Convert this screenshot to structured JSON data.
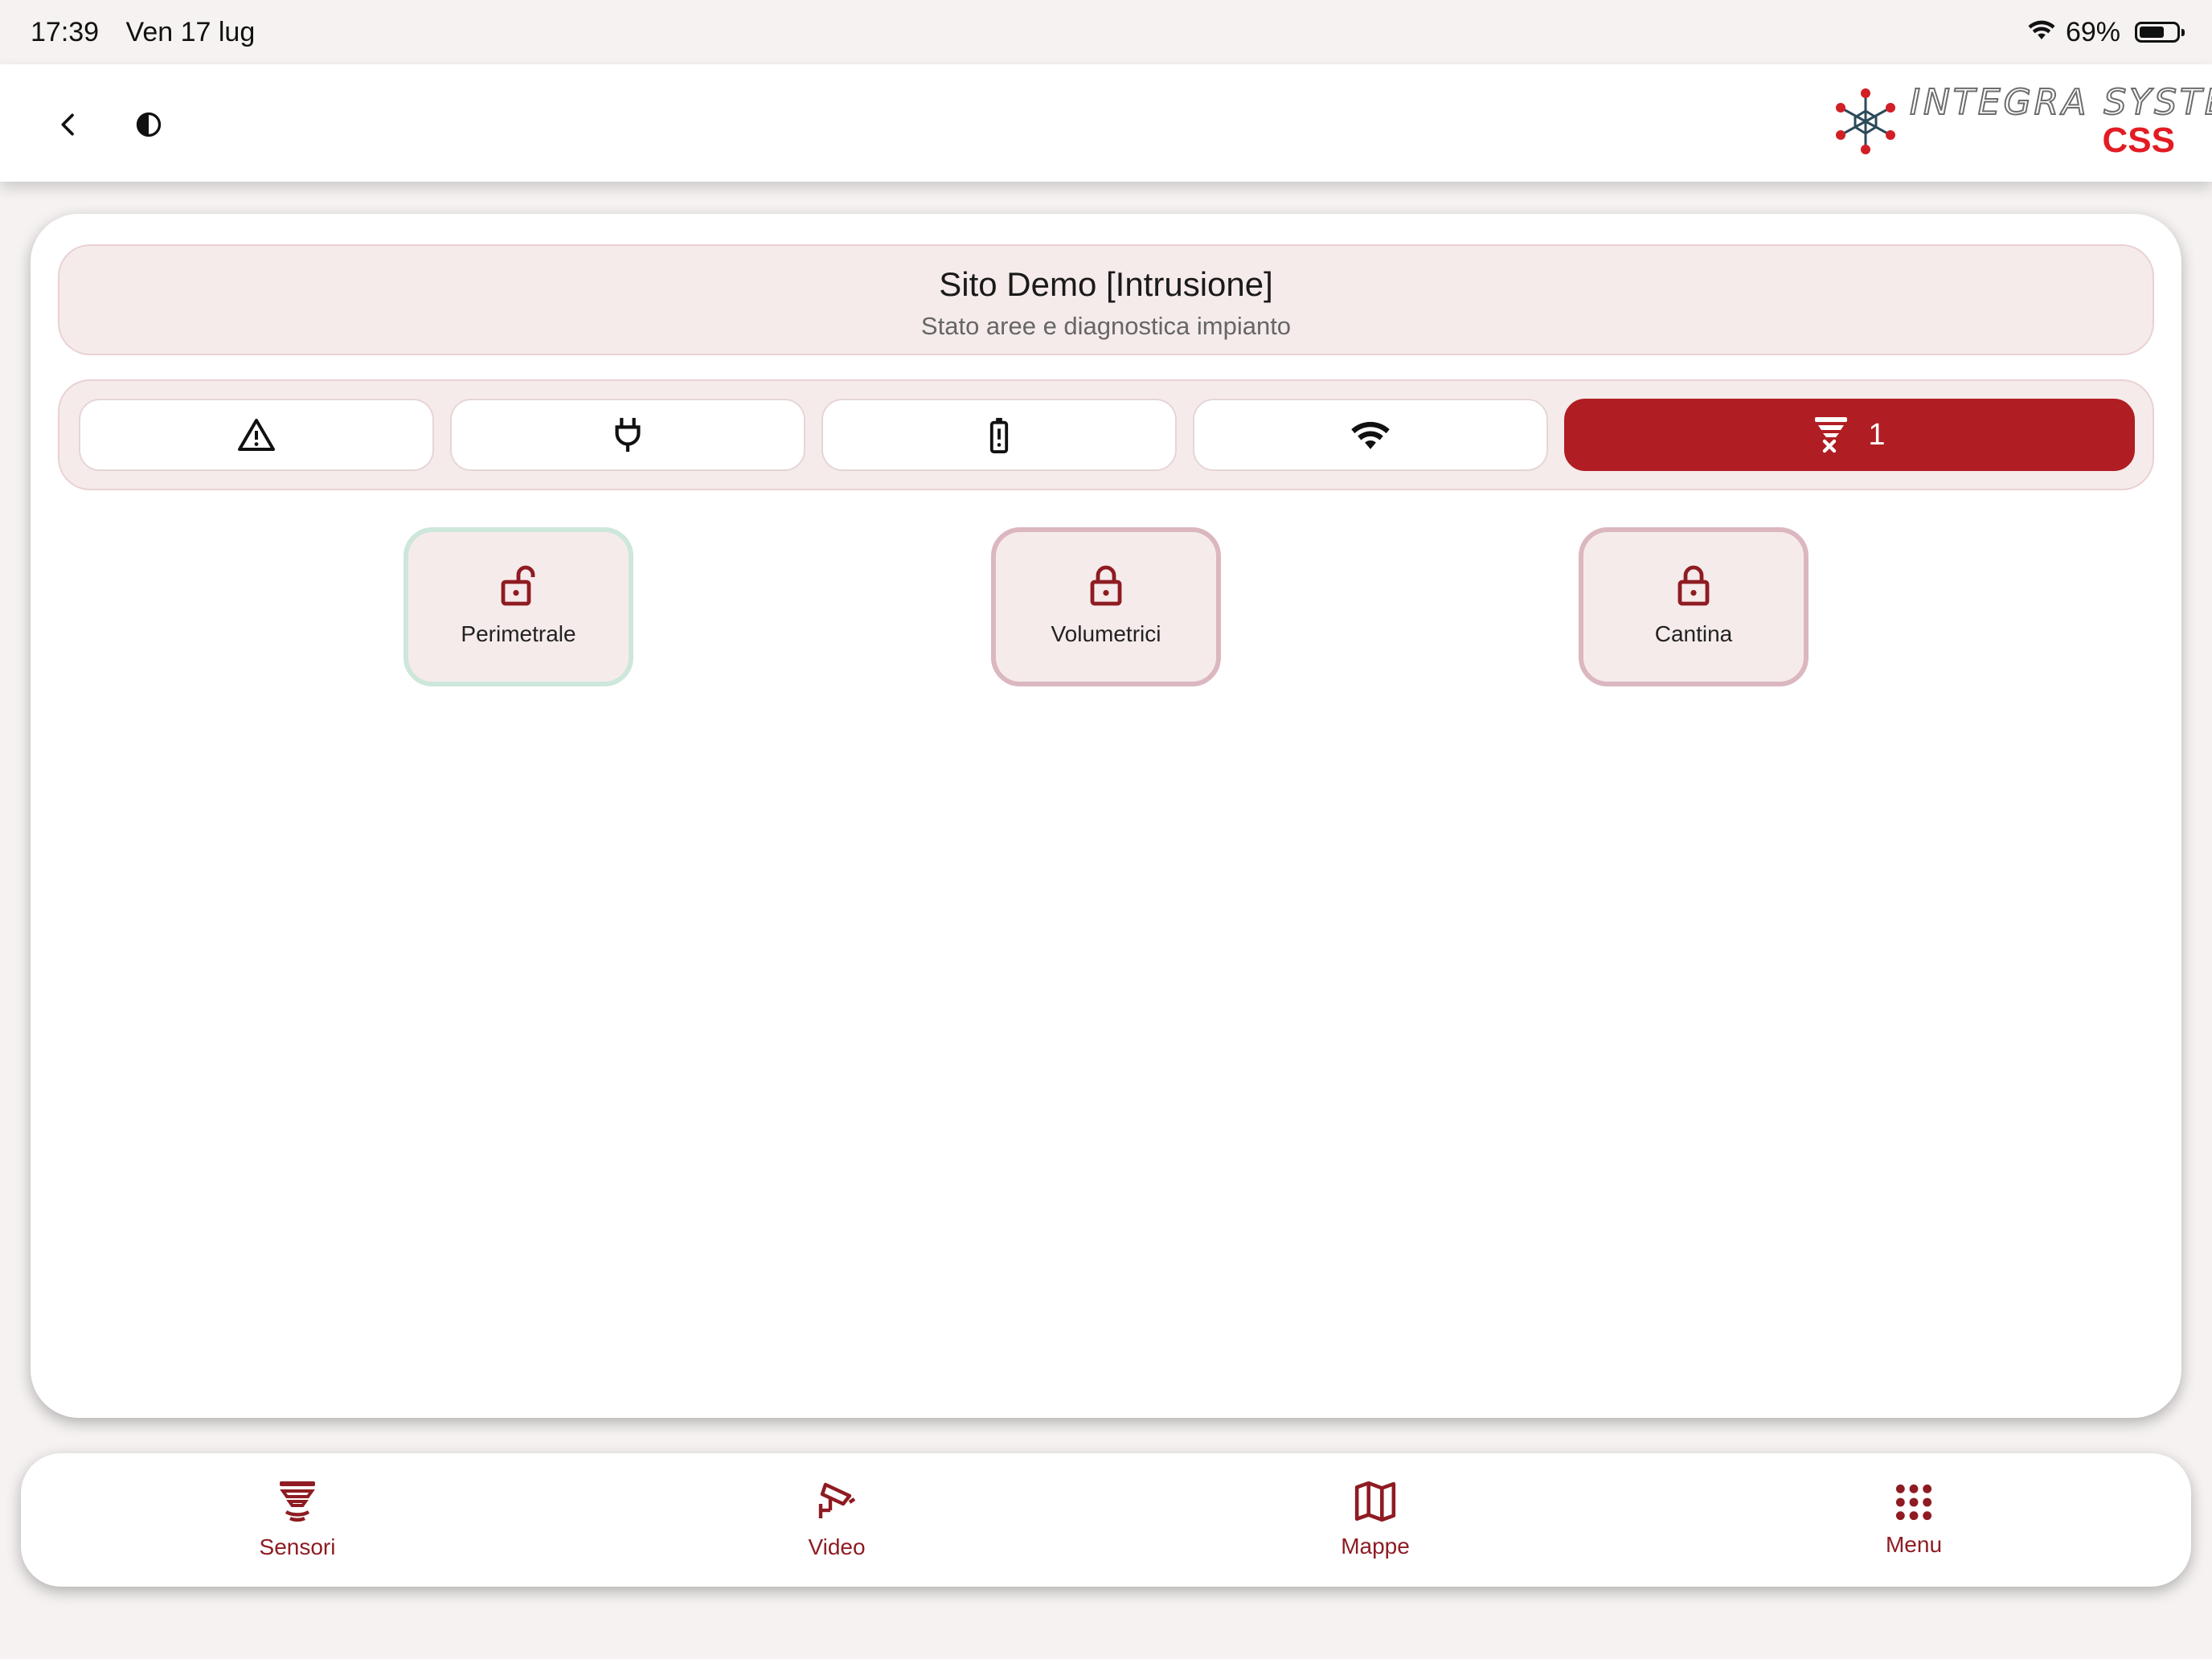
{
  "status_bar": {
    "time": "17:39",
    "date": "Ven 17 lug",
    "battery": "69%",
    "battery_level": 0.69
  },
  "header": {
    "logo_text": "INTEGRA SYSTEM",
    "logo_sub": "CSS",
    "icons": [
      "chevron-left-icon",
      "contrast-icon"
    ]
  },
  "site": {
    "title": "Sito Demo [Intrusione]",
    "subtitle": "Stato aree e diagnostica impianto"
  },
  "filters": [
    {
      "icon": "warning-icon"
    },
    {
      "icon": "plug-icon"
    },
    {
      "icon": "battery-alert-icon"
    },
    {
      "icon": "wifi-icon"
    },
    {
      "icon": "sensor-excluded-icon",
      "count": "1",
      "active": true
    }
  ],
  "areas": [
    {
      "label": "Perimetrale",
      "state": "unlocked"
    },
    {
      "label": "Volumetrici",
      "state": "locked"
    },
    {
      "label": "Cantina",
      "state": "locked"
    }
  ],
  "bottom_nav": [
    {
      "label": "Sensori",
      "icon": "sensor-icon"
    },
    {
      "label": "Video",
      "icon": "cctv-camera-icon"
    },
    {
      "label": "Mappe",
      "icon": "map-icon"
    },
    {
      "label": "Menu",
      "icon": "grid-dots-icon"
    }
  ],
  "colors": {
    "accent": "#b01e23",
    "icon_red": "#8e1c22",
    "tile_bg": "#f6ebeb",
    "tile_border_locked": "#dbb7bf",
    "tile_border_unlocked": "#cde7db",
    "logo_red": "#e31b23"
  }
}
